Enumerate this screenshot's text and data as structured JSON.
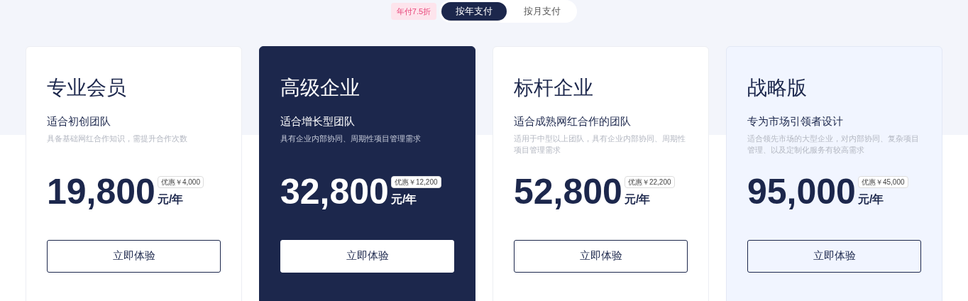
{
  "billing_toggle": {
    "discount_badge": "年付7.5折",
    "options": [
      {
        "label": "按年支付",
        "selected": true
      },
      {
        "label": "按月支付",
        "selected": false
      }
    ]
  },
  "plans": [
    {
      "kind": "plain",
      "name": "专业会员",
      "subtitle": "适合初创团队",
      "description": "具备基础网红合作知识，需提升合作次数",
      "price": "19,800",
      "discount": "优惠￥4,000",
      "unit": "元/年",
      "button": "立即体验"
    },
    {
      "kind": "dark",
      "name": "高级企业",
      "subtitle": "适合增长型团队",
      "description": "具有企业内部协同、周期性项目管理需求",
      "price": "32,800",
      "discount": "优惠￥12,200",
      "unit": "元/年",
      "button": "立即体验"
    },
    {
      "kind": "plain",
      "name": "标杆企业",
      "subtitle": "适合成熟网红合作的团队",
      "description": "适用于中型以上团队，具有企业内部协同、周期性项目管理需求",
      "price": "52,800",
      "discount": "优惠￥22,200",
      "unit": "元/年",
      "button": "立即体验"
    },
    {
      "kind": "tinted",
      "name": "战略版",
      "subtitle": "专为市场引领者设计",
      "description": "适合领先市场的大型企业，对内部协同、复杂项目管理、以及定制化服务有较高需求",
      "price": "95,000",
      "discount": "优惠￥45,000",
      "unit": "元/年",
      "button": "立即体验"
    }
  ]
}
